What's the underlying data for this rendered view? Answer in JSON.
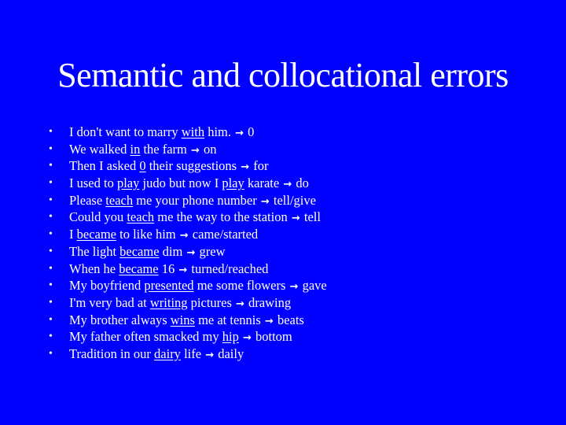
{
  "slide": {
    "title": "Semantic and collocational errors",
    "background_color": "#0000fe",
    "text_color": "#ffffff",
    "bullet_glyph": "•",
    "arrow_icon": "→",
    "items": [
      {
        "before": "I don't want to marry ",
        "error": "with",
        "after": " him.",
        "correction": "0"
      },
      {
        "before": "We walked ",
        "error": "in",
        "after": " the farm",
        "correction": "on"
      },
      {
        "before": "Then I asked ",
        "error": "0",
        "after": " their suggestions",
        "correction": "for"
      },
      {
        "before": "I used to ",
        "error": "play",
        "middle": " judo but now I ",
        "error2": "play",
        "after": " karate",
        "correction": "do"
      },
      {
        "before": "Please ",
        "error": "teach",
        "after": " me your phone number",
        "correction": "tell/give"
      },
      {
        "before": "Could you ",
        "error": "teach",
        "after": " me the way to the station",
        "correction": "tell"
      },
      {
        "before": "I ",
        "error": "became",
        "after": " to like him",
        "correction": "came/started"
      },
      {
        "before": "The light ",
        "error": "became",
        "after": " dim",
        "correction": "grew"
      },
      {
        "before": "When he ",
        "error": "became",
        "after": " 16",
        "correction": "turned/reached"
      },
      {
        "before": "My boyfriend ",
        "error": "presented",
        "after": " me some flowers",
        "correction": "gave"
      },
      {
        "before": "I'm very bad at ",
        "error": "writing",
        "after": " pictures",
        "correction": "drawing"
      },
      {
        "before": "My brother always ",
        "error": "wins",
        "after": " me at tennis",
        "correction": "beats"
      },
      {
        "before": "My father often smacked my ",
        "error": "hip",
        "after": "",
        "correction": "bottom"
      },
      {
        "before": "Tradition in our ",
        "error": "dairy",
        "after": " life",
        "correction": "daily"
      }
    ]
  }
}
